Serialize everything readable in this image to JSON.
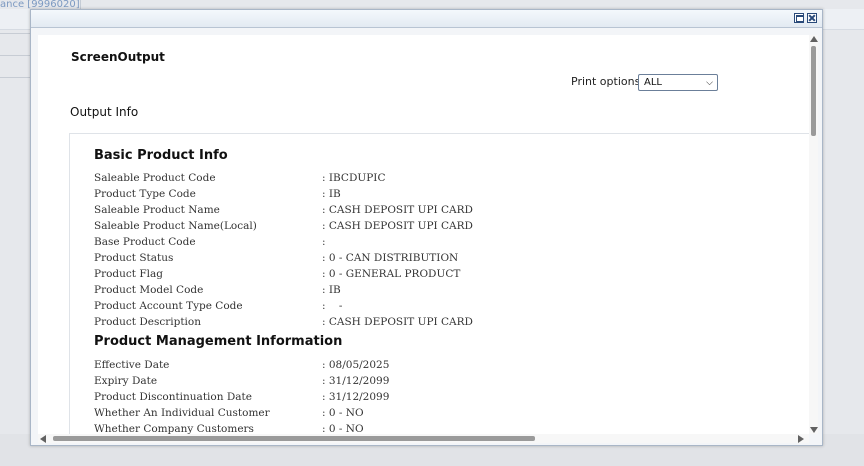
{
  "background": {
    "tab_text": "ance [9996020]"
  },
  "screen": {
    "title": "ScreenOutput",
    "print_options_label": "Print options:",
    "print_options_value": "ALL",
    "output_info_label": "Output Info"
  },
  "basic_product_info": {
    "title": "Basic Product Info",
    "rows": [
      {
        "label": "Saleable Product Code",
        "value": ": IBCDUPIC"
      },
      {
        "label": "Product Type Code",
        "value": ": IB"
      },
      {
        "label": "Saleable Product Name",
        "value": ": CASH DEPOSIT UPI CARD"
      },
      {
        "label": "Saleable Product Name(Local)",
        "value": ": CASH DEPOSIT UPI CARD"
      },
      {
        "label": "Base Product Code",
        "value": ":"
      },
      {
        "label": "Product Status",
        "value": ": 0 - CAN DISTRIBUTION"
      },
      {
        "label": "Product Flag",
        "value": ": 0 - GENERAL PRODUCT"
      },
      {
        "label": "Product Model Code",
        "value": ": IB"
      },
      {
        "label": "Product Account Type Code",
        "value": ":    -"
      },
      {
        "label": "Product Description",
        "value": ": CASH DEPOSIT UPI CARD"
      }
    ]
  },
  "product_management_info": {
    "title": "Product Management Information",
    "rows": [
      {
        "label": "Effective Date",
        "value": ": 08/05/2025"
      },
      {
        "label": "Expiry Date",
        "value": ": 31/12/2099"
      },
      {
        "label": "Product Discontinuation Date",
        "value": ": 31/12/2099"
      },
      {
        "label": "Whether An Individual Customer",
        "value": ": 0 - NO"
      },
      {
        "label": "Whether Company Customers",
        "value": ": 0 - NO"
      }
    ]
  }
}
